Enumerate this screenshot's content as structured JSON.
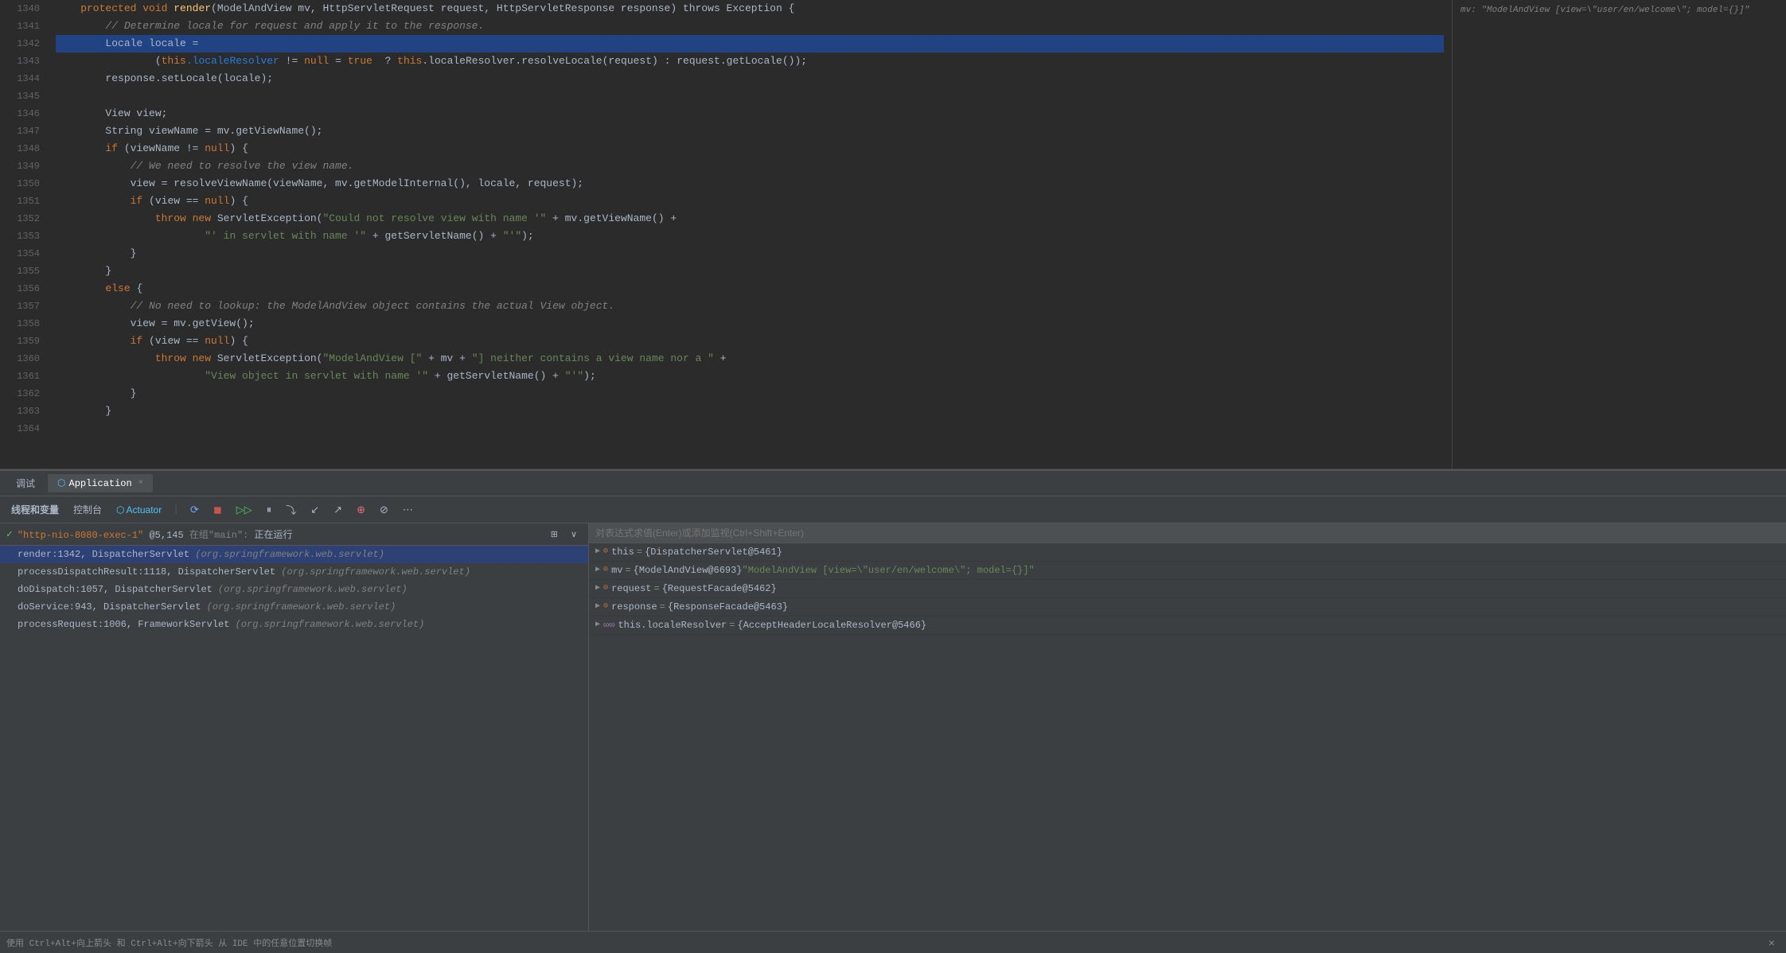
{
  "editor": {
    "lines": [
      {
        "num": "1340",
        "content": [
          {
            "text": "    protected void ",
            "cls": "kw"
          },
          {
            "text": "render",
            "cls": "method"
          },
          {
            "text": "(ModelAndView mv, HttpServletRequest request, HttpServletResponse response) throws Exception {",
            "cls": ""
          },
          {
            "text": "    mv: \"ModelAndView [view=\\\"user/en/welcome\\\"; model={}]\"",
            "cls": "comment",
            "right": true
          }
        ]
      },
      {
        "num": "1341",
        "content": [
          {
            "text": "        // Determine locale for request and apply it to the response.",
            "cls": "comment"
          }
        ]
      },
      {
        "num": "1342",
        "content": [
          {
            "text": "        Locale locale =",
            "cls": "",
            "highlighted": true
          }
        ]
      },
      {
        "num": "1343",
        "content": [
          {
            "text": "                (",
            "cls": ""
          },
          {
            "text": "this",
            "cls": "kw"
          },
          {
            "text": ".localeResolver",
            "cls": "blue-link"
          },
          {
            "text": " != ",
            "cls": ""
          },
          {
            "text": "null",
            "cls": "kw"
          },
          {
            "text": " = ",
            "cls": ""
          },
          {
            "text": "true",
            "cls": "kw"
          },
          {
            "text": "  ? ",
            "cls": ""
          },
          {
            "text": "this",
            "cls": "kw"
          },
          {
            "text": ".localeResolver.resolveLocale(request) : request.getLocale());",
            "cls": ""
          }
        ]
      },
      {
        "num": "1344",
        "content": [
          {
            "text": "        response.setLocale(locale);",
            "cls": ""
          }
        ]
      },
      {
        "num": "1345",
        "content": []
      },
      {
        "num": "1346",
        "content": [
          {
            "text": "        View view;",
            "cls": ""
          }
        ]
      },
      {
        "num": "1347",
        "content": [
          {
            "text": "        String viewName = mv.getViewName();",
            "cls": ""
          }
        ]
      },
      {
        "num": "1348",
        "content": [
          {
            "text": "        ",
            "cls": ""
          },
          {
            "text": "if",
            "cls": "kw"
          },
          {
            "text": " (viewName != ",
            "cls": ""
          },
          {
            "text": "null",
            "cls": "kw"
          },
          {
            "text": ") {",
            "cls": ""
          }
        ]
      },
      {
        "num": "1349",
        "content": [
          {
            "text": "            // We need to resolve the view name.",
            "cls": "comment"
          }
        ]
      },
      {
        "num": "1350",
        "content": [
          {
            "text": "            view = resolveViewName(viewName, mv.getModelInternal(), locale, request);",
            "cls": ""
          }
        ]
      },
      {
        "num": "1351",
        "content": [
          {
            "text": "            ",
            "cls": ""
          },
          {
            "text": "if",
            "cls": "kw"
          },
          {
            "text": " (view == ",
            "cls": ""
          },
          {
            "text": "null",
            "cls": "kw"
          },
          {
            "text": ") {",
            "cls": ""
          }
        ]
      },
      {
        "num": "1352",
        "content": [
          {
            "text": "                ",
            "cls": ""
          },
          {
            "text": "throw new",
            "cls": "kw"
          },
          {
            "text": " ServletException(",
            "cls": ""
          },
          {
            "text": "\"Could not resolve view with name '\"",
            "cls": "string"
          },
          {
            "text": " + mv.getViewName() +",
            "cls": ""
          }
        ]
      },
      {
        "num": "1353",
        "content": [
          {
            "text": "                        ",
            "cls": ""
          },
          {
            "text": "\"' in servlet with name '\"",
            "cls": "string"
          },
          {
            "text": " + getServletName() + ",
            "cls": ""
          },
          {
            "text": "\"'\"",
            "cls": "string"
          },
          {
            "text": ");",
            "cls": ""
          }
        ]
      },
      {
        "num": "1354",
        "content": [
          {
            "text": "            }",
            "cls": ""
          }
        ]
      },
      {
        "num": "1355",
        "content": [
          {
            "text": "        }",
            "cls": ""
          }
        ]
      },
      {
        "num": "1356",
        "content": [
          {
            "text": "        ",
            "cls": ""
          },
          {
            "text": "else",
            "cls": "kw"
          },
          {
            "text": " {",
            "cls": ""
          }
        ]
      },
      {
        "num": "1357",
        "content": [
          {
            "text": "            // No need to lookup: the ModelAndView object contains the actual View object.",
            "cls": "comment"
          }
        ]
      },
      {
        "num": "1358",
        "content": [
          {
            "text": "            view = mv.getView();",
            "cls": ""
          }
        ]
      },
      {
        "num": "1359",
        "content": [
          {
            "text": "            ",
            "cls": ""
          },
          {
            "text": "if",
            "cls": "kw"
          },
          {
            "text": " (view == ",
            "cls": ""
          },
          {
            "text": "null",
            "cls": "kw"
          },
          {
            "text": ") {",
            "cls": ""
          }
        ]
      },
      {
        "num": "1360",
        "content": [
          {
            "text": "                ",
            "cls": ""
          },
          {
            "text": "throw new",
            "cls": "kw"
          },
          {
            "text": " ServletException(",
            "cls": ""
          },
          {
            "text": "\"ModelAndView [\"",
            "cls": "string"
          },
          {
            "text": " + mv + ",
            "cls": ""
          },
          {
            "text": "\"] neither contains a view name nor a \"",
            "cls": "string"
          },
          {
            "text": " +",
            "cls": ""
          }
        ]
      },
      {
        "num": "1361",
        "content": [
          {
            "text": "                        ",
            "cls": ""
          },
          {
            "text": "\"View object in servlet with name '\"",
            "cls": "string"
          },
          {
            "text": " + getServletName() + ",
            "cls": ""
          },
          {
            "text": "\"'\"",
            "cls": "string"
          },
          {
            "text": ");",
            "cls": ""
          }
        ]
      },
      {
        "num": "1362",
        "content": [
          {
            "text": "            }",
            "cls": ""
          }
        ]
      },
      {
        "num": "1363",
        "content": [
          {
            "text": "        }",
            "cls": ""
          }
        ]
      },
      {
        "num": "1364",
        "content": []
      }
    ],
    "right_panel_text": "mv: \"ModelAndView [view=\\\"user/en/welcome\\\"; model={}]\""
  },
  "debugger": {
    "tabs": [
      {
        "label": "调试",
        "active": false
      },
      {
        "label": "Application",
        "active": true,
        "icon": "app-icon"
      },
      {
        "label": "×",
        "is_close": true
      }
    ],
    "toolbar": {
      "buttons": [
        {
          "label": "线程和变量",
          "active": true
        },
        {
          "label": "控制台"
        },
        {
          "label": "Actuator",
          "icon": "actuator-icon"
        },
        {
          "label": "⟳",
          "title": "restart"
        },
        {
          "label": "◻",
          "title": "stop"
        },
        {
          "label": "▷▷",
          "title": "resume"
        },
        {
          "label": "⏸",
          "title": "pause"
        },
        {
          "label": "⤵",
          "title": "step-over"
        },
        {
          "label": "↙",
          "title": "step-into"
        },
        {
          "label": "↗",
          "title": "step-out"
        },
        {
          "label": "⊕",
          "title": "add-breakpoint"
        },
        {
          "label": "⊘",
          "title": "mute-breakpoints"
        },
        {
          "label": "⋯",
          "title": "more"
        }
      ]
    },
    "thread": {
      "name": "\"http-nio-8080-exec-1\"@5,145",
      "group": "在组\"main\"",
      "status": "正在运行",
      "checked": true
    },
    "stack_frames": [
      {
        "method": "render:1342, DispatcherServlet",
        "class": "(org.springframework.web.servlet)",
        "active": true
      },
      {
        "method": "processDispatchResult:1118, DispatcherServlet",
        "class": "(org.springframework.web.servlet)"
      },
      {
        "method": "doDispatch:1057, DispatcherServlet",
        "class": "(org.springframework.web.servlet)"
      },
      {
        "method": "doService:943, DispatcherServlet",
        "class": "(org.springframework.web.servlet)"
      },
      {
        "method": "processRequest:1006, FrameworkServlet",
        "class": "(org.springframework.web.servlet)"
      }
    ],
    "variables_placeholder": "对表达式求值(Enter)或添加监视(Ctrl+Shift+Enter)",
    "variables": [
      {
        "arrow": "▶",
        "icon": "this",
        "name": "this",
        "eq": "=",
        "value": "{DispatcherServlet@5461}",
        "type": "obj"
      },
      {
        "arrow": "▶",
        "icon": "mv",
        "name": "mv",
        "eq": "=",
        "value": "{ModelAndView@6693}",
        "extra": "\"ModelAndView [view=\\\"user/en/welcome\\\"; model={}]\"",
        "type": "str"
      },
      {
        "arrow": "▶",
        "icon": "request",
        "name": "request",
        "eq": "=",
        "value": "{RequestFacade@5462}",
        "type": "obj"
      },
      {
        "arrow": "▶",
        "icon": "response",
        "name": "response",
        "eq": "=",
        "value": "{ResponseFacade@5463}",
        "type": "obj"
      },
      {
        "arrow": "▶",
        "icon": "localeResolver",
        "name": "this.localeResolver",
        "eq": "=",
        "value": "{AcceptHeaderLocaleResolver@5466}",
        "type": "obj",
        "special": "∞∞"
      }
    ],
    "status_bar": {
      "hint": "使用 Ctrl+Alt+向上箭头 和 Ctrl+Alt+向下箭头 从 IDE 中的任意位置切换帧"
    }
  }
}
